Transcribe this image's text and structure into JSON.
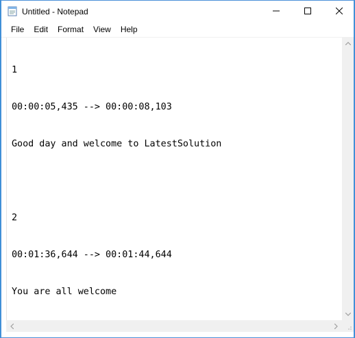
{
  "window": {
    "title": "Untitled - Notepad",
    "accent_border": "#4a90d9",
    "desktop_bg": "#3a8fd6"
  },
  "menu": {
    "items": [
      "File",
      "Edit",
      "Format",
      "View",
      "Help"
    ]
  },
  "editor": {
    "lines": [
      "1",
      "00:00:05,435 --> 00:00:08,103",
      "Good day and welcome to LatestSolution",
      "",
      "2",
      "00:01:36,644 --> 00:01:44,644",
      "You are all welcome"
    ]
  },
  "icons": {
    "app": "notepad-icon",
    "minimize": "minimize-icon",
    "maximize": "maximize-icon",
    "close": "close-icon"
  }
}
